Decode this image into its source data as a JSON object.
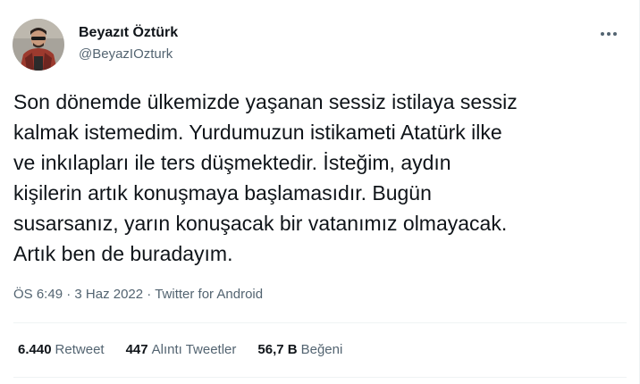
{
  "author": {
    "display_name": "Beyazıt Öztürk",
    "handle": "@BeyazIOzturk"
  },
  "icons": {
    "more": "more-dots-icon",
    "avatar": "profile-photo"
  },
  "tweet": {
    "lines": [
      "Son dönemde ülkemizde yaşanan sessiz istilaya sessiz",
      "kalmak istemedim. Yurdumuzun istikameti Atatürk ilke",
      "ve inkılapları ile ters düşmektedir. İsteğim, aydın",
      "kişilerin artık konuşmaya başlamasıdır. Bugün",
      "susarsanız, yarın konuşacak bir vatanımız olmayacak.",
      "Artık ben de buradayım."
    ]
  },
  "meta": {
    "time": "ÖS 6:49",
    "separator": "·",
    "date": "3 Haz 2022",
    "source": "Twitter for Android"
  },
  "stats": {
    "retweets": {
      "count": "6.440",
      "label": "Retweet"
    },
    "quotes": {
      "count": "447",
      "label": "Alıntı Tweetler"
    },
    "likes": {
      "count": "56,7 B",
      "label": "Beğeni"
    }
  },
  "colors": {
    "text_primary": "#0f1419",
    "text_secondary": "#536471",
    "divider": "#eff3f4"
  }
}
